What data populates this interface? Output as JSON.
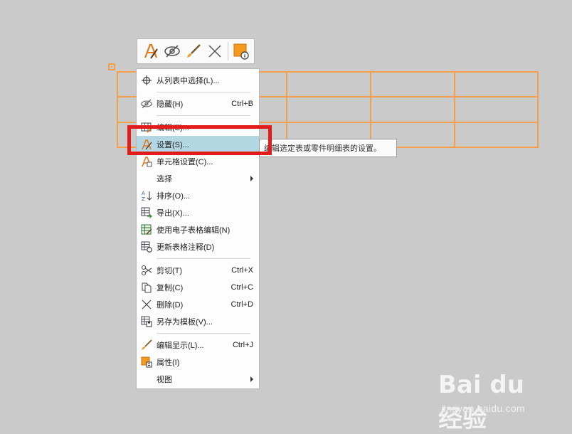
{
  "toolbar": {
    "buttons": [
      {
        "name": "text-style-icon"
      },
      {
        "name": "hide-eye-icon"
      },
      {
        "name": "brush-icon"
      },
      {
        "name": "delete-x-icon"
      },
      {
        "name": "properties-icon"
      }
    ]
  },
  "menu": {
    "items": [
      {
        "label": "从列表中选择(L)...",
        "shortcut": "",
        "icon": "crosshair-icon"
      },
      {
        "label": "隐藏(H)",
        "shortcut": "Ctrl+B",
        "icon": "hide-eye-icon"
      },
      {
        "label": "编辑(E)...",
        "shortcut": "",
        "icon": "table-edit-icon"
      },
      {
        "label": "设置(S)...",
        "shortcut": "",
        "icon": "settings-pen-icon",
        "highlighted": true
      },
      {
        "label": "单元格设置(C)...",
        "shortcut": "",
        "icon": "cell-settings-icon"
      },
      {
        "label": "选择",
        "shortcut": "",
        "icon": "",
        "submenu": true
      },
      {
        "label": "排序(O)...",
        "shortcut": "",
        "icon": "sort-az-icon"
      },
      {
        "label": "导出(X)...",
        "shortcut": "",
        "icon": "export-table-icon"
      },
      {
        "label": "使用电子表格编辑(N)",
        "shortcut": "",
        "icon": "spreadsheet-edit-icon"
      },
      {
        "label": "更新表格注释(D)",
        "shortcut": "",
        "icon": "update-table-icon"
      },
      {
        "label": "剪切(T)",
        "shortcut": "Ctrl+X",
        "icon": "cut-icon"
      },
      {
        "label": "复制(C)",
        "shortcut": "Ctrl+C",
        "icon": "copy-icon"
      },
      {
        "label": "删除(D)",
        "shortcut": "Ctrl+D",
        "icon": "delete-x-icon"
      },
      {
        "label": "另存为模板(V)...",
        "shortcut": "",
        "icon": "save-template-icon"
      },
      {
        "label": "编辑显示(L)...",
        "shortcut": "Ctrl+J",
        "icon": "brush-icon"
      },
      {
        "label": "属性(I)",
        "shortcut": "",
        "icon": "properties-icon"
      },
      {
        "label": "视图",
        "shortcut": "",
        "icon": "",
        "submenu": true
      }
    ]
  },
  "tooltip": {
    "text": "编辑选定表或零件明细表的设置。"
  },
  "watermark": {
    "brand": "Bai du 经验",
    "url": "jingyan.baidu.com"
  },
  "colors": {
    "table": "#f3a04c",
    "highlight": "#b3d7e2",
    "annotation": "#e21b1b"
  }
}
